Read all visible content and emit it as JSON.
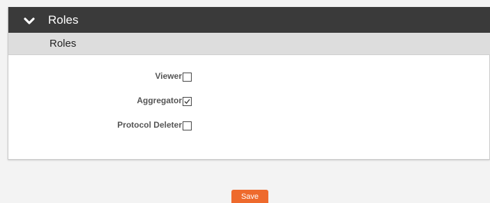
{
  "panel": {
    "title": "Roles",
    "toggle_icon": "chevron-down-icon",
    "subheader": "Roles"
  },
  "roles": [
    {
      "label": "Viewer",
      "checked": false
    },
    {
      "label": "Aggregator",
      "checked": true
    },
    {
      "label": "Protocol Deleter",
      "checked": false
    }
  ],
  "actions": {
    "save_label": "Save"
  },
  "colors": {
    "header_bg": "#3a3a3a",
    "subheader_bg": "#dddddd",
    "save_bg": "#ee6a2d"
  }
}
